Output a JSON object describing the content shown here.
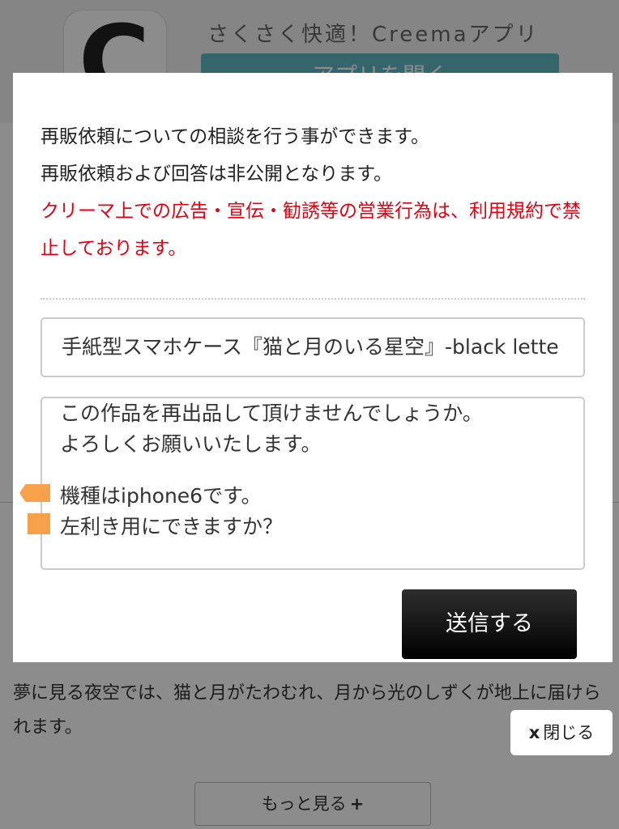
{
  "banner": {
    "app_icon_letter": "C",
    "tagline": "さくさく快適！Creemaアプリ",
    "open_app_button": "アプリを開く"
  },
  "background": {
    "description_text": "夢に見る夜空では、猫と月がたわむれ、月から光のしずくが地上に届けられます。",
    "more_button": "もっと見る",
    "more_icon": "+"
  },
  "modal": {
    "message_line1": "再販依頼についての相談を行う事ができます。",
    "message_line2": "再販依頼および回答は非公開となります。",
    "warning_text": "クリーマ上での広告・宣伝・勧誘等の営業行為は、利用規約で禁止しております。",
    "title_field_value": "手紙型スマホケース『猫と月のいる星空』-black lette",
    "message_lines": [
      "この作品を再出品して頂けませんでしょうか。",
      "よろしくお願いいたします。",
      "",
      "機種はiphone6です。",
      "左利き用にできますか？"
    ],
    "send_button": "送信する"
  },
  "close_button": {
    "icon": "x",
    "label": "閉じる"
  },
  "colors": {
    "warning": "#e50012",
    "overlay": "rgba(0,0,0,0.45)",
    "send_button": "#000000",
    "accent": "#5fb8c4"
  }
}
